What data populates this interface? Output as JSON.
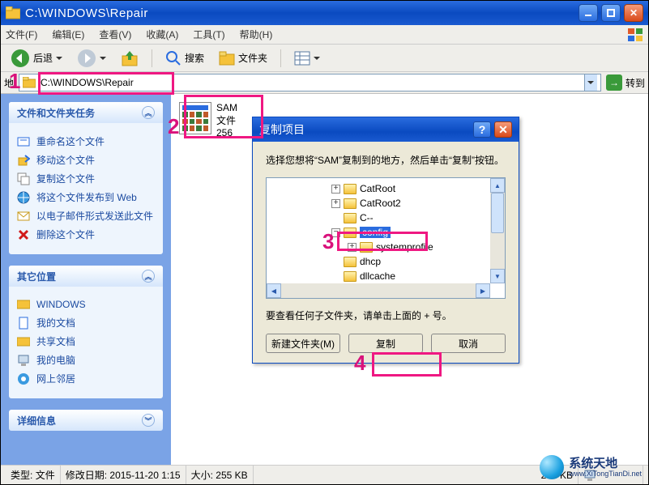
{
  "window": {
    "title": "C:\\WINDOWS\\Repair",
    "path": "C:\\WINDOWS\\Repair"
  },
  "menu": {
    "file": "文件(F)",
    "edit": "编辑(E)",
    "view": "查看(V)",
    "favorites": "收藏(A)",
    "tools": "工具(T)",
    "help": "帮助(H)"
  },
  "toolbar": {
    "back": "后退",
    "search": "搜索",
    "folders": "文件夹"
  },
  "address": {
    "label": "地",
    "go": "转到"
  },
  "panels": {
    "tasks": {
      "title": "文件和文件夹任务",
      "items": [
        "重命名这个文件",
        "移动这个文件",
        "复制这个文件",
        "将这个文件发布到 Web",
        "以电子邮件形式发送此文件",
        "删除这个文件"
      ]
    },
    "other": {
      "title": "其它位置",
      "items": [
        "WINDOWS",
        "我的文档",
        "共享文档",
        "我的电脑",
        "网上邻居"
      ]
    },
    "details": {
      "title": "详细信息"
    }
  },
  "file": {
    "name": "SAM",
    "type": "文件",
    "size": "256"
  },
  "dialog": {
    "title": "复制项目",
    "message": "选择您想将“SAM”复制到的地方，然后单击“复制”按钮。",
    "tree": [
      {
        "label": "CatRoot",
        "indent": 80,
        "expander": "+"
      },
      {
        "label": "CatRoot2",
        "indent": 80,
        "expander": "+"
      },
      {
        "label": "C--",
        "indent": 80,
        "expander": ""
      },
      {
        "label": "config",
        "indent": 80,
        "expander": "−",
        "selected": true
      },
      {
        "label": "systemprofile",
        "indent": 100,
        "expander": "+"
      },
      {
        "label": "dhcp",
        "indent": 80,
        "expander": ""
      },
      {
        "label": "dllcache",
        "indent": 80,
        "expander": ""
      }
    ],
    "hint": "要查看任何子文件夹，请单击上面的 + 号。",
    "buttons": {
      "new_folder": "新建文件夹(M)",
      "copy": "复制",
      "cancel": "取消"
    }
  },
  "status": {
    "type_label": "类型:",
    "type_value": "文件",
    "mod_label": "修改日期:",
    "mod_value": "2015-11-20 1:15",
    "size_label": "大小:",
    "size_value": "255 KB",
    "right": "255 KB"
  },
  "annotations": {
    "n1": "1",
    "n2": "2",
    "n3": "3",
    "n4": "4"
  },
  "watermark": {
    "cn": "系统天地",
    "en": "www.XiTongTianDi.net"
  }
}
